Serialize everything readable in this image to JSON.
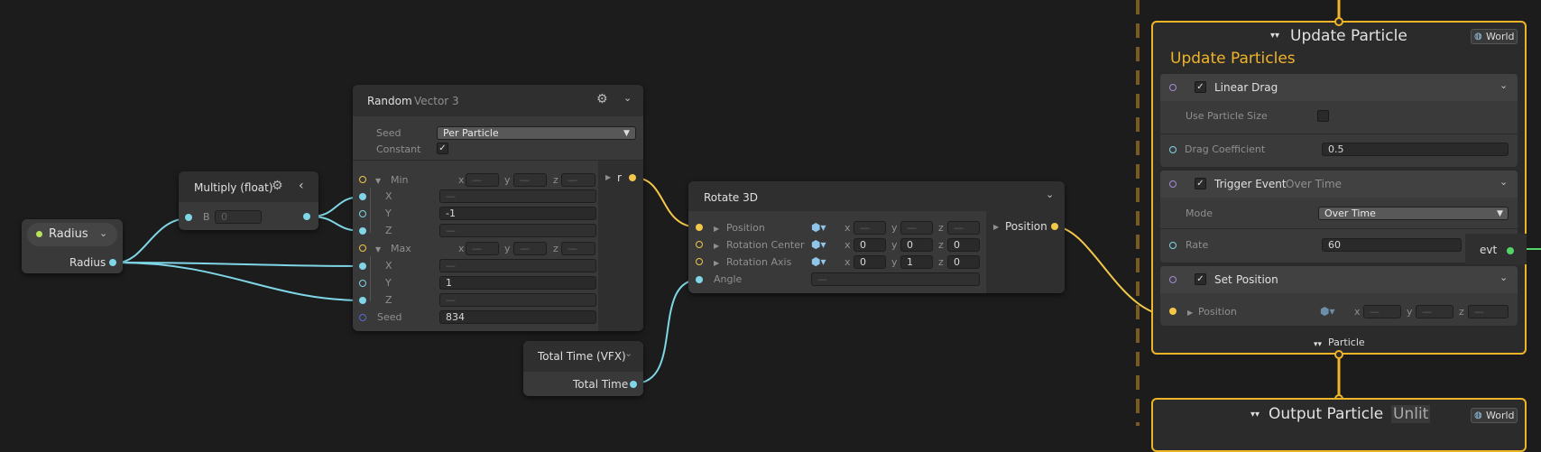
{
  "radius_node": {
    "title": "Radius",
    "output_label": "Radius"
  },
  "multiply_node": {
    "title": "Multiply (float)",
    "b_label": "B",
    "b_value": "0"
  },
  "random_node": {
    "title": "Random",
    "subtitle": "Vector 3",
    "seed_label": "Seed",
    "seed_mode": "Per Particle",
    "constant_label": "Constant",
    "min_label": "Min",
    "max_label": "Max",
    "x_label": "X",
    "y_label": "Y",
    "z_label": "Z",
    "x": "x",
    "y": "y",
    "z": "z",
    "min_y": "-1",
    "max_y": "1",
    "seed_row_label": "Seed",
    "seed_value": "834",
    "out_label": "r",
    "placeholder": "—"
  },
  "total_time_node": {
    "title": "Total Time (VFX)",
    "output_label": "Total Time"
  },
  "rotate_node": {
    "title": "Rotate 3D",
    "position": "Position",
    "rotation_center": "Rotation Center",
    "rotation_axis": "Rotation Axis",
    "angle": "Angle",
    "x": "x",
    "y": "y",
    "z": "z",
    "center_x": "0",
    "center_y": "0",
    "center_z": "0",
    "axis_x": "0",
    "axis_y": "1",
    "axis_z": "0",
    "out_label": "Position",
    "placeholder": "—"
  },
  "update_context": {
    "title": "Update Particle",
    "space": "World",
    "name": "Update Particles",
    "linear_drag": {
      "title": "Linear Drag",
      "use_size_label": "Use Particle Size",
      "drag_label": "Drag Coefficient",
      "drag_value": "0.5"
    },
    "trigger_event": {
      "title": "Trigger Event",
      "mode_inline": "Over Time",
      "mode_label": "Mode",
      "mode_value": "Over Time",
      "rate_label": "Rate",
      "rate_value": "60",
      "evt_label": "evt"
    },
    "set_position": {
      "title": "Set",
      "attribute": "Position",
      "position_label": "Position",
      "x": "x",
      "y": "y",
      "z": "z",
      "placeholder": "—"
    },
    "footer": "Particle"
  },
  "output_context": {
    "title": "Output Particle",
    "shader": "Unlit",
    "space": "World"
  },
  "colors": {
    "background": "#1c1c1c",
    "node": "#393939",
    "header": "#2f2f2f",
    "accent": "#f0b429",
    "float_port": "#7fd6e6",
    "vector_port": "#f2c74a",
    "edge_float": "#7fd6e6",
    "edge_vector": "#f2c74a"
  }
}
